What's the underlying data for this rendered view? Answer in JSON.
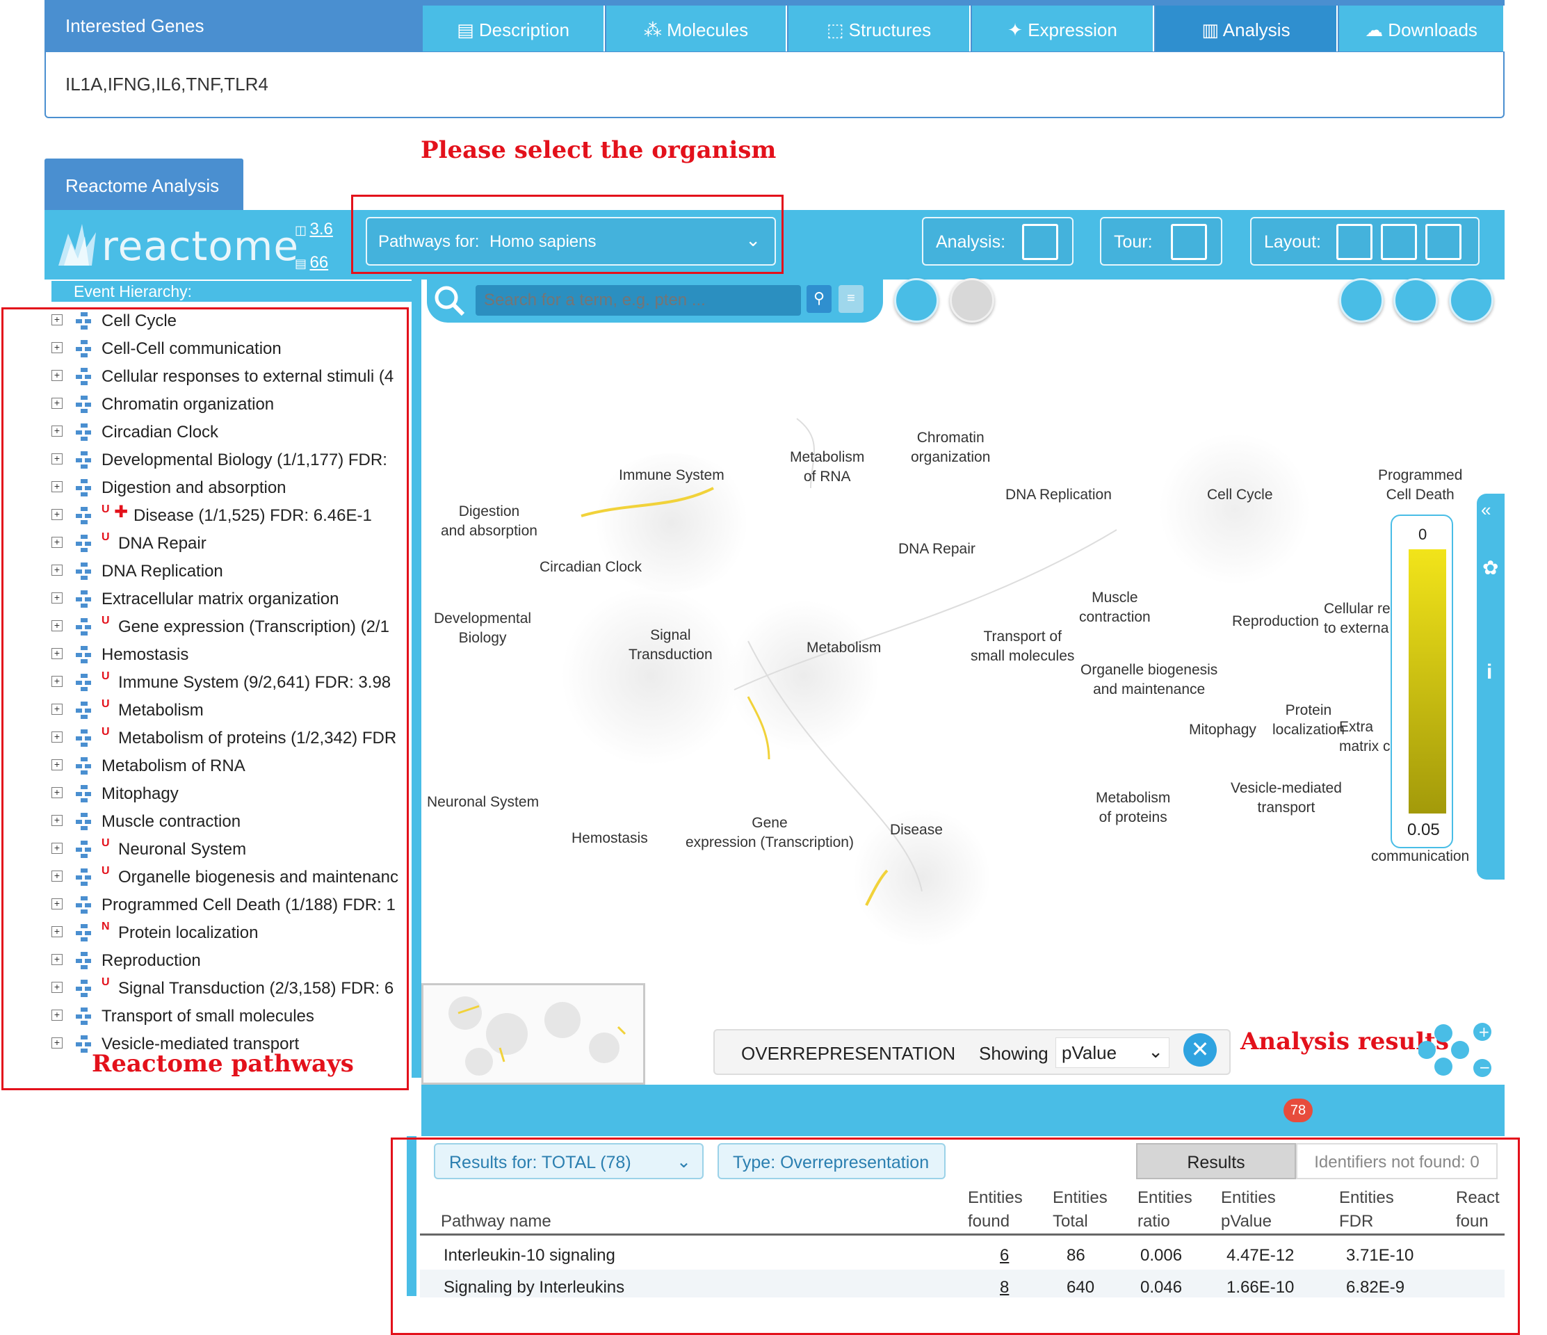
{
  "interested_genes": {
    "header": "Interested Genes",
    "value": "IL1A,IFNG,IL6,TNF,TLR4"
  },
  "annotations": {
    "select_organism": "Please select the organism",
    "analysis_results": "Analysis results",
    "reactome_pathways": "Reactome pathways"
  },
  "reactome": {
    "tab_label": "Reactome Analysis",
    "logo_text": "reactome",
    "version_links": [
      "3.6",
      "66"
    ],
    "pathways_for_label": "Pathways for:",
    "pathways_for_value": "Homo sapiens",
    "analysis_label": "Analysis:",
    "tour_label": "Tour:",
    "layout_label": "Layout:",
    "event_hierarchy_title": "Event Hierarchy:",
    "search_placeholder": "Search for a term, e.g. pten ..."
  },
  "hierarchy": [
    {
      "label": "Cell Cycle",
      "badges": ""
    },
    {
      "label": "Cell-Cell communication",
      "badges": ""
    },
    {
      "label": "Cellular responses to external stimuli  (4",
      "badges": ""
    },
    {
      "label": "Chromatin organization",
      "badges": ""
    },
    {
      "label": "Circadian Clock",
      "badges": ""
    },
    {
      "label": "Developmental Biology  (1/1,177) FDR:",
      "badges": ""
    },
    {
      "label": "Digestion and absorption",
      "badges": ""
    },
    {
      "label": "Disease  (1/1,525) FDR: 6.46E-1",
      "badges": "U+"
    },
    {
      "label": "DNA Repair",
      "badges": "U"
    },
    {
      "label": "DNA Replication",
      "badges": ""
    },
    {
      "label": "Extracellular matrix organization",
      "badges": ""
    },
    {
      "label": "Gene expression (Transcription)  (2/1",
      "badges": "U"
    },
    {
      "label": "Hemostasis",
      "badges": ""
    },
    {
      "label": "Immune System  (9/2,641) FDR: 3.98",
      "badges": "U"
    },
    {
      "label": "Metabolism",
      "badges": "U"
    },
    {
      "label": "Metabolism of proteins  (1/2,342) FDR",
      "badges": "U"
    },
    {
      "label": "Metabolism of RNA",
      "badges": ""
    },
    {
      "label": "Mitophagy",
      "badges": ""
    },
    {
      "label": "Muscle contraction",
      "badges": ""
    },
    {
      "label": "Neuronal System",
      "badges": "U"
    },
    {
      "label": "Organelle biogenesis and maintenanc",
      "badges": "U"
    },
    {
      "label": "Programmed Cell Death  (1/188) FDR: 1",
      "badges": ""
    },
    {
      "label": "Protein localization",
      "badges": "N"
    },
    {
      "label": "Reproduction",
      "badges": ""
    },
    {
      "label": "Signal Transduction  (2/3,158) FDR: 6",
      "badges": "U"
    },
    {
      "label": "Transport of small molecules",
      "badges": ""
    },
    {
      "label": "Vesicle-mediated transport",
      "badges": ""
    }
  ],
  "map_labels": {
    "immune_system": "Immune System",
    "metabolism_rna": "Metabolism\nof RNA",
    "chromatin": "Chromatin\norganization",
    "dna_replication": "DNA Replication",
    "cell_cycle": "Cell Cycle",
    "programmed_cell_death": "Programmed\nCell Death",
    "digestion": "Digestion\nand absorption",
    "dna_repair": "DNA Repair",
    "circadian": "Circadian Clock",
    "developmental": "Developmental\nBiology",
    "signal": "Signal\nTransduction",
    "metabolism": "Metabolism",
    "muscle": "Muscle\ncontraction",
    "transport": "Transport of\nsmall molecules",
    "reproduction": "Reproduction",
    "cellular_resp": "Cellular re\nto externa",
    "organelle": "Organelle biogenesis\nand maintenance",
    "protein_loc": "Protein\nlocalization",
    "mitophagy": "Mitophagy",
    "extra": "Extra\nmatrix c",
    "neuronal": "Neuronal System",
    "hemostasis": "Hemostasis",
    "gene_expr": "Gene\nexpression (Transcription)",
    "disease": "Disease",
    "metab_proteins": "Metabolism\nof proteins",
    "vesicle": "Vesicle-mediated\ntransport",
    "communication": "communication"
  },
  "legend": {
    "top": "0",
    "bottom": "0.05",
    "colors": [
      "#f2e41a",
      "#a39a0a"
    ]
  },
  "overrepresentation": {
    "type_label": "OVERREPRESENTATION",
    "showing_label": "Showing",
    "showing_value": "pValue"
  },
  "bottom_tabs": [
    {
      "label": "Description",
      "icon": "clipboard-icon"
    },
    {
      "label": "Molecules",
      "icon": "molecule-icon"
    },
    {
      "label": "Structures",
      "icon": "structure-icon"
    },
    {
      "label": "Expression",
      "icon": "expression-icon"
    },
    {
      "label": "Analysis",
      "icon": "analysis-icon",
      "badge": "78",
      "active": true
    },
    {
      "label": "Downloads",
      "icon": "cloud-download-icon"
    }
  ],
  "results": {
    "results_for": "Results for:  TOTAL (78)",
    "type": "Type: Overrepresentation",
    "tab_results": "Results",
    "tab_not_found": "Identifiers not found: 0",
    "columns": [
      {
        "line1": "",
        "line2": "Pathway name"
      },
      {
        "line1": "Entities",
        "line2": "found"
      },
      {
        "line1": "Entities",
        "line2": "Total"
      },
      {
        "line1": "Entities",
        "line2": "ratio"
      },
      {
        "line1": "Entities",
        "line2": "pValue"
      },
      {
        "line1": "Entities",
        "line2": "FDR"
      },
      {
        "line1": "React",
        "line2": "foun"
      }
    ],
    "rows": [
      {
        "name": "Interleukin-10 signaling",
        "found": "6",
        "total": "86",
        "ratio": "0.006",
        "pvalue": "4.47E-12",
        "fdr": "3.71E-10"
      },
      {
        "name": "Signaling by Interleukins",
        "found": "8",
        "total": "640",
        "ratio": "0.046",
        "pvalue": "1.66E-10",
        "fdr": "6.82E-9"
      }
    ]
  }
}
